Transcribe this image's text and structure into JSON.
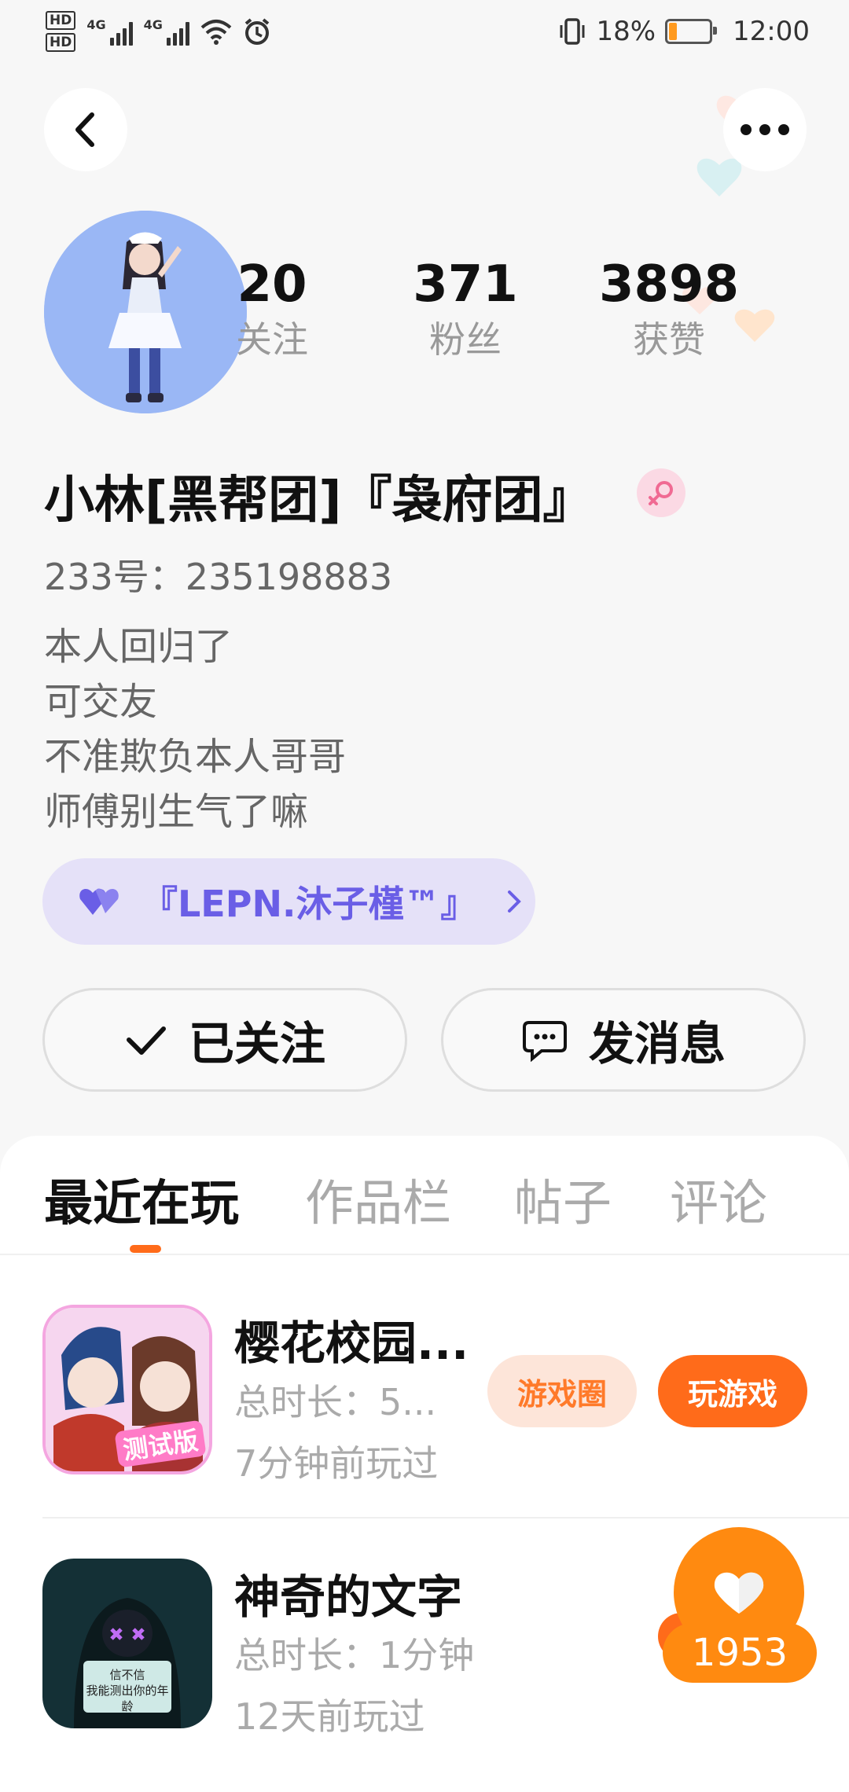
{
  "status_bar": {
    "hd1": "HD",
    "hd2": "HD",
    "net1": "4G",
    "net2": "4G",
    "battery_percent": "18%",
    "time": "12:00"
  },
  "profile": {
    "stats": [
      {
        "value": "20",
        "label": "关注"
      },
      {
        "value": "371",
        "label": "粉丝"
      },
      {
        "value": "3898",
        "label": "获赞"
      }
    ],
    "name": "小林[黑帮团]『袅府团』",
    "uid": "233号：235198883",
    "bio": [
      "本人回归了",
      "可交友",
      "不准欺负本人哥哥",
      "师傅别生气了嘛"
    ],
    "tag": "『LEPN.沐子槿™』"
  },
  "actions": {
    "follow_label": "已关注",
    "message_label": "发消息"
  },
  "tabs": [
    "最近在玩",
    "作品栏",
    "帖子",
    "评论"
  ],
  "games": [
    {
      "title": "樱花校园...",
      "duration": "总时长：5...",
      "last_played": "7分钟前玩过",
      "icon_badge": "测试版",
      "circle_label": "游戏圈",
      "play_label": "玩游戏"
    },
    {
      "title": "神奇的文字",
      "duration": "总时长：1分钟",
      "last_played": "12天前玩过",
      "icon_text_1": "信不信",
      "icon_text_2": "我能测出你的年龄"
    }
  ],
  "floating_like_count": "1953",
  "colors": {
    "accent_orange": "#ff6b1a",
    "tag_purple": "#6a5ee6",
    "tag_bg": "#e5e1f8"
  }
}
